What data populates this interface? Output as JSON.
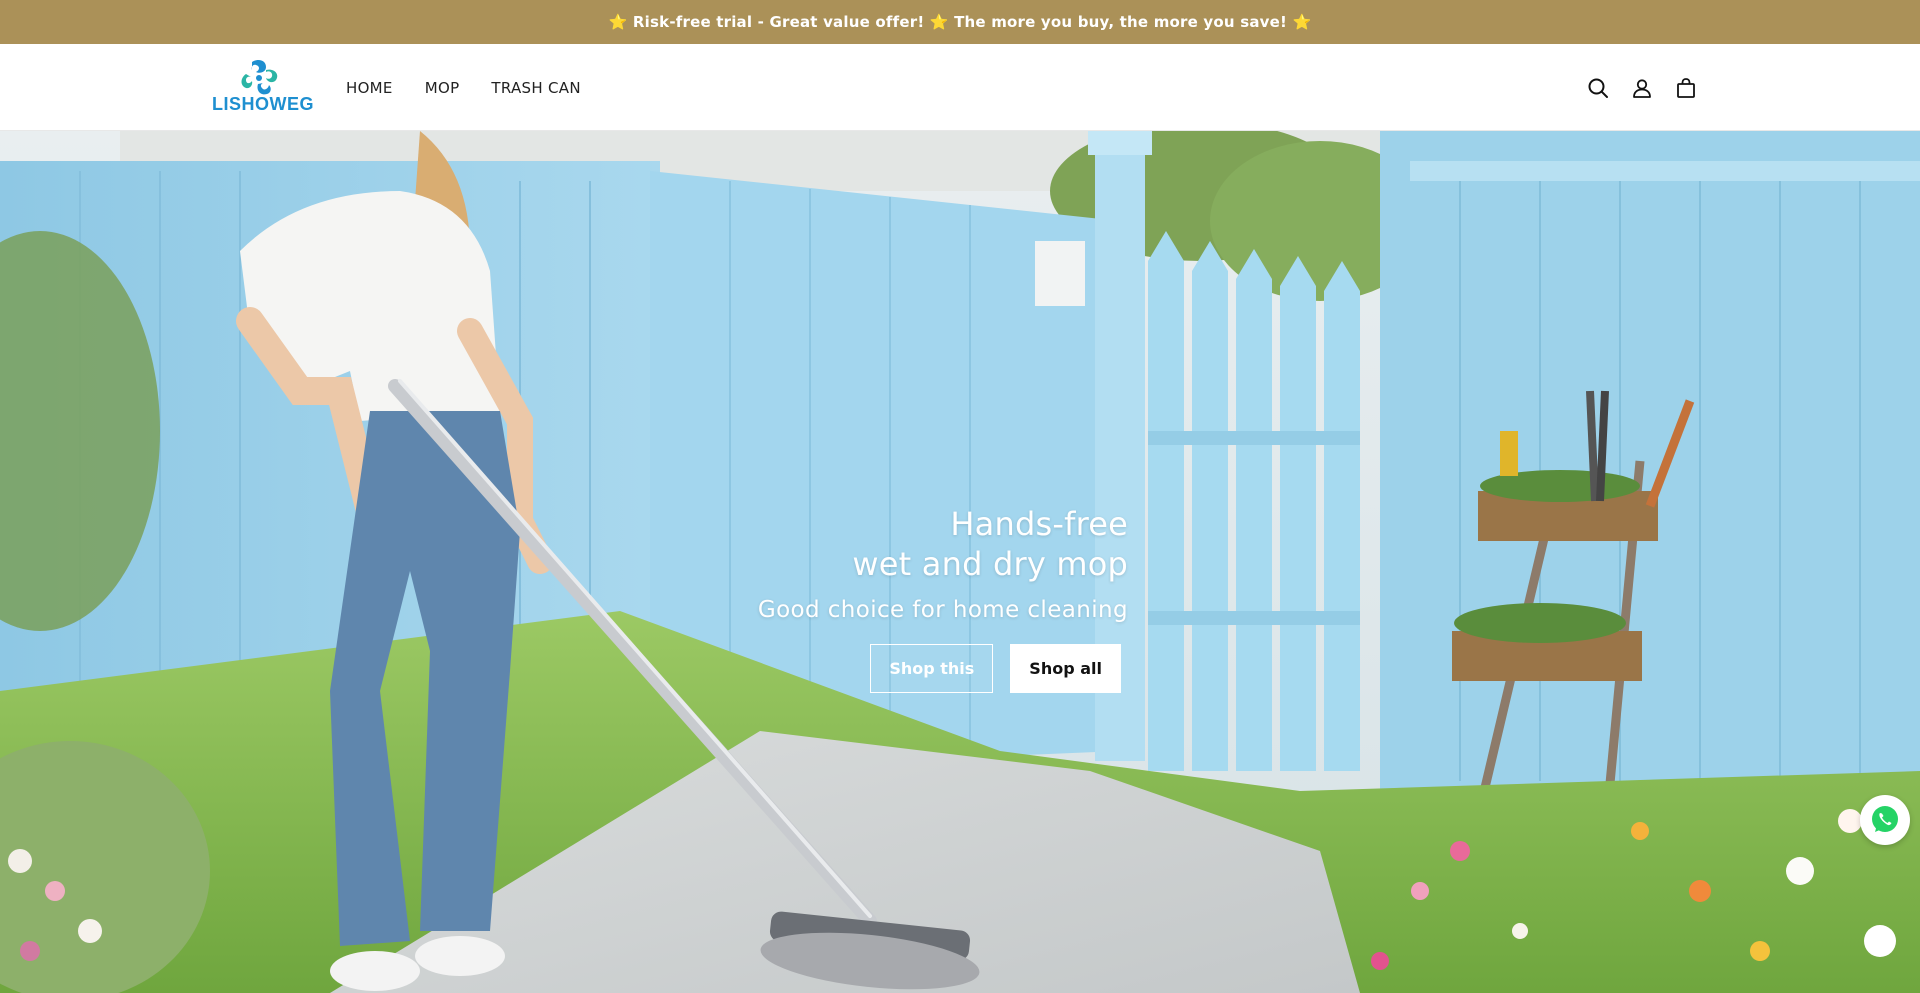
{
  "announcement": {
    "text": "⭐ Risk-free trial - Great value offer! ⭐ The more you buy, the more you save! ⭐"
  },
  "header": {
    "logo_text": "LISHOWEG",
    "nav": [
      {
        "label": "HOME"
      },
      {
        "label": "MOP"
      },
      {
        "label": "TRASH CAN"
      }
    ],
    "icons": [
      "search-icon",
      "account-icon",
      "cart-icon"
    ]
  },
  "hero": {
    "title_line1": "Hands-free",
    "title_line2": "wet and dry mop",
    "subtitle": "Good choice for home cleaning",
    "button_primary": "Shop this",
    "button_secondary": "Shop all"
  },
  "colors": {
    "announcement_bg": "#ab9158",
    "logo_blue": "#1e8fd0",
    "logo_teal": "#2bb5a5",
    "fence_blue": "#9fd3ea",
    "grass": "#8bc35a",
    "whatsapp_green": "#25d366"
  },
  "floating": {
    "chat_icon": "whatsapp-icon"
  }
}
